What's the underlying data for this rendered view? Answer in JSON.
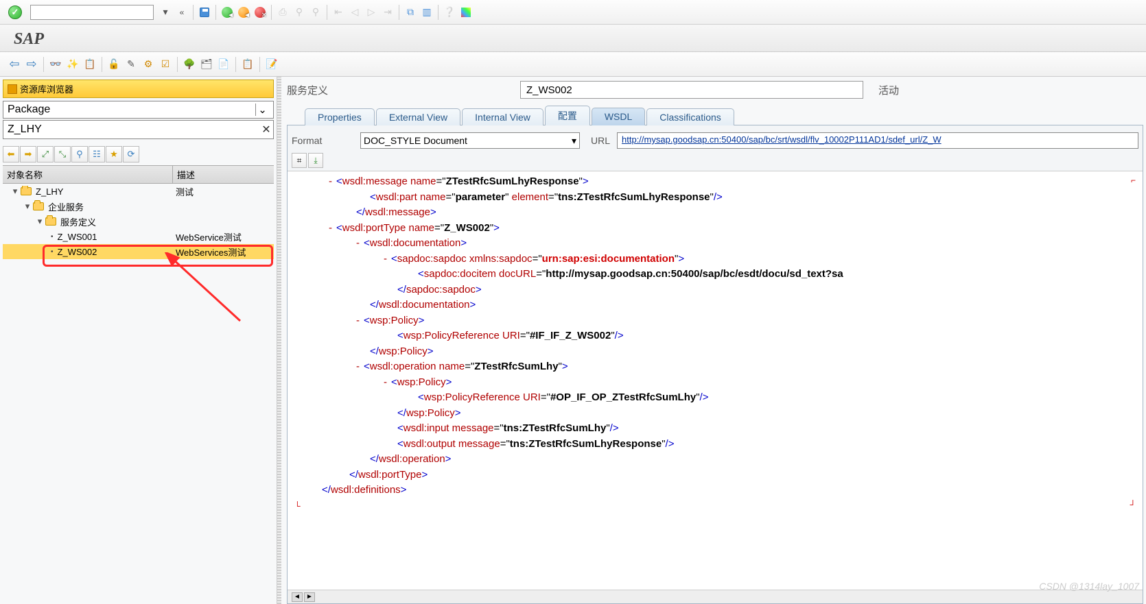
{
  "title": "SAP",
  "repo_header": "资源库浏览器",
  "selector": {
    "value": "Package"
  },
  "package_input": "Z_LHY",
  "tree_cols": {
    "name": "对象名称",
    "desc": "描述"
  },
  "tree": {
    "root": {
      "name": "Z_LHY",
      "desc": "测试"
    },
    "n1": {
      "name": "企业服务",
      "desc": ""
    },
    "n2": {
      "name": "服务定义",
      "desc": ""
    },
    "leaf1": {
      "name": "Z_WS001",
      "desc": "WebService测试"
    },
    "leaf2": {
      "name": "Z_WS002",
      "desc": "WebServices测试"
    }
  },
  "def": {
    "label": "服务定义",
    "value": "Z_WS002",
    "status": "活动"
  },
  "tabs": {
    "t1": "Properties",
    "t2": "External View",
    "t3": "Internal View",
    "t4": "配置",
    "t5": "WSDL",
    "t6": "Classifications"
  },
  "fmt": {
    "label": "Format",
    "value": "DOC_STYLE Document",
    "url_label": "URL",
    "url": "http://mysap.goodsap.cn:50400/sap/bc/srt/wsdl/flv_10002P111AD1/sdef_url/Z_W"
  },
  "wsdl": {
    "msg_name": "ZTestRfcSumLhyResponse",
    "part_name": "parameter",
    "part_elem": "tns:ZTestRfcSumLhyResponse",
    "port_name": "Z_WS002",
    "sapdoc_ns": "urn:sap:esi:documentation",
    "docurl": "http://mysap.goodsap.cn:50400/sap/bc/esdt/docu/sd_text?sa",
    "policy_uri1": "#IF_IF_Z_WS002",
    "op_name": "ZTestRfcSumLhy",
    "policy_uri2": "#OP_IF_OP_ZTestRfcSumLhy",
    "input_msg": "tns:ZTestRfcSumLhy",
    "output_msg": "tns:ZTestRfcSumLhyResponse"
  },
  "watermark": "CSDN @1314lay_1007"
}
